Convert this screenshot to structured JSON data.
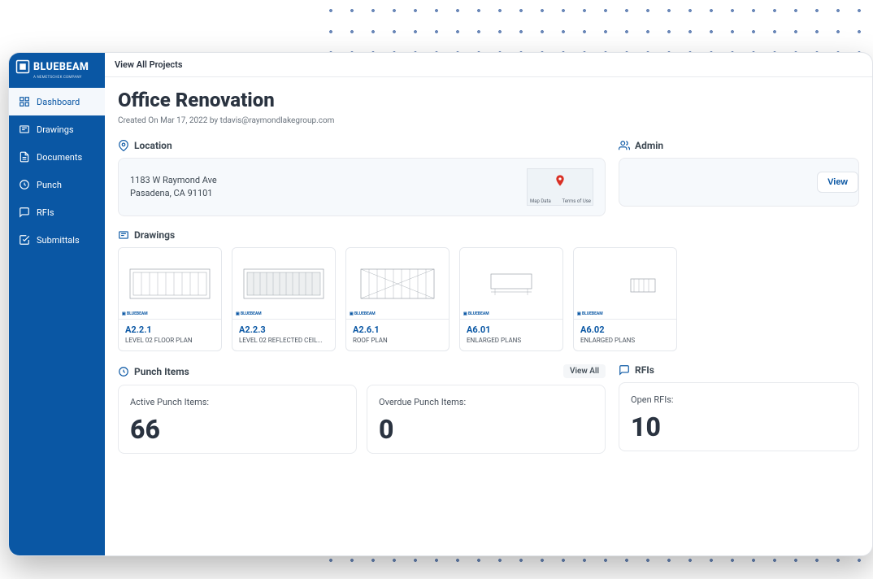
{
  "brand": {
    "name": "BLUEBEAM",
    "tagline": "A NEMETSCHEK COMPANY"
  },
  "sidebar": {
    "items": [
      {
        "label": "Dashboard"
      },
      {
        "label": "Drawings"
      },
      {
        "label": "Documents"
      },
      {
        "label": "Punch"
      },
      {
        "label": "RFIs"
      },
      {
        "label": "Submittals"
      }
    ]
  },
  "topbar": {
    "view_all": "View All Projects"
  },
  "page": {
    "title": "Office Renovation",
    "meta": "Created On Mar 17, 2022 by tdavis@raymondlakegroup.com"
  },
  "location": {
    "heading": "Location",
    "line1": "1183 W Raymond Ave",
    "line2": "Pasadena, CA 91101",
    "map_data_label": "Map Data",
    "map_terms_label": "Terms of Use"
  },
  "admin": {
    "heading": "Admin",
    "view_label": "View"
  },
  "drawings": {
    "heading": "Drawings",
    "items": [
      {
        "code": "A2.2.1",
        "name": "LEVEL 02 FLOOR PLAN"
      },
      {
        "code": "A2.2.3",
        "name": "LEVEL 02 REFLECTED CEIL..."
      },
      {
        "code": "A2.6.1",
        "name": "ROOF PLAN"
      },
      {
        "code": "A6.01",
        "name": "ENLARGED PLANS"
      },
      {
        "code": "A6.02",
        "name": "ENLARGED PLANS"
      }
    ]
  },
  "punch": {
    "heading": "Punch Items",
    "view_all": "View All",
    "active_label": "Active Punch Items:",
    "active_value": "66",
    "overdue_label": "Overdue Punch Items:",
    "overdue_value": "0"
  },
  "rfis": {
    "heading": "RFIs",
    "open_label": "Open RFIs:",
    "open_value": "10"
  }
}
